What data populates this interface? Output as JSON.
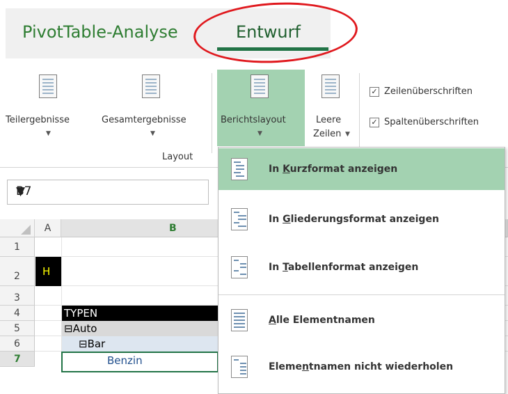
{
  "tabs": {
    "pivot_analyse": "PivotTable-Analyse",
    "entwurf": "Entwurf"
  },
  "ribbon": {
    "teilergebnisse": "Teilergebnisse",
    "gesamtergebnisse": "Gesamtergebnisse",
    "berichtslayout": "Berichtslayout",
    "leere_line1": "Leere",
    "leere_line2": "Zeilen",
    "group_layout": "Layout",
    "zeilen_ueberschriften": "Zeilenüberschriften",
    "spalten_ueberschriften": "Spaltenüberschriften",
    "checkmark": "✓"
  },
  "namebox": {
    "value": "B7"
  },
  "grid": {
    "col_a": "A",
    "col_b": "B",
    "rows": [
      "1",
      "2",
      "3",
      "4",
      "5",
      "6",
      "7"
    ],
    "a2": "H",
    "b4": "TYPEN",
    "b5": "⊟Auto",
    "b6": "⊟Bar",
    "b7": "Benzin"
  },
  "dropdown": {
    "items": [
      {
        "pre": "In ",
        "key": "K",
        "post": "urzformat anzeigen"
      },
      {
        "pre": "In ",
        "key": "G",
        "post": "liederungsformat anzeigen"
      },
      {
        "pre": "In ",
        "key": "T",
        "post": "abellenformat anzeigen"
      },
      {
        "pre": "",
        "key": "A",
        "post": "lle Elementnamen"
      },
      {
        "pre": "Eleme",
        "key": "n",
        "post": "tnamen nicht wiederholen"
      }
    ],
    "highlight_color": "#a3d2b1"
  }
}
